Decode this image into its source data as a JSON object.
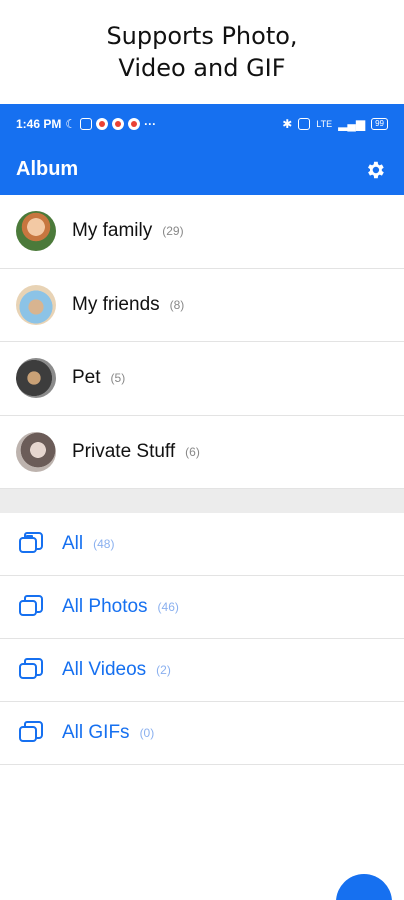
{
  "promo": {
    "title": "Supports Photo,\nVideo and GIF"
  },
  "status": {
    "time": "1:46 PM",
    "battery": "99",
    "network": "LTE"
  },
  "app": {
    "title": "Album",
    "settings_icon": "gear-icon"
  },
  "albums": [
    {
      "name": "My family",
      "count": "(29)"
    },
    {
      "name": "My friends",
      "count": "(8)"
    },
    {
      "name": "Pet",
      "count": "(5)"
    },
    {
      "name": "Private Stuff",
      "count": "(6)"
    }
  ],
  "folders": [
    {
      "label": "All",
      "count": "(48)"
    },
    {
      "label": "All Photos",
      "count": "(46)"
    },
    {
      "label": "All Videos",
      "count": "(2)"
    },
    {
      "label": "All GIFs",
      "count": "(0)"
    }
  ],
  "colors": {
    "accent": "#1670f0",
    "divider": "#e3e3e3",
    "band": "#ececec"
  }
}
